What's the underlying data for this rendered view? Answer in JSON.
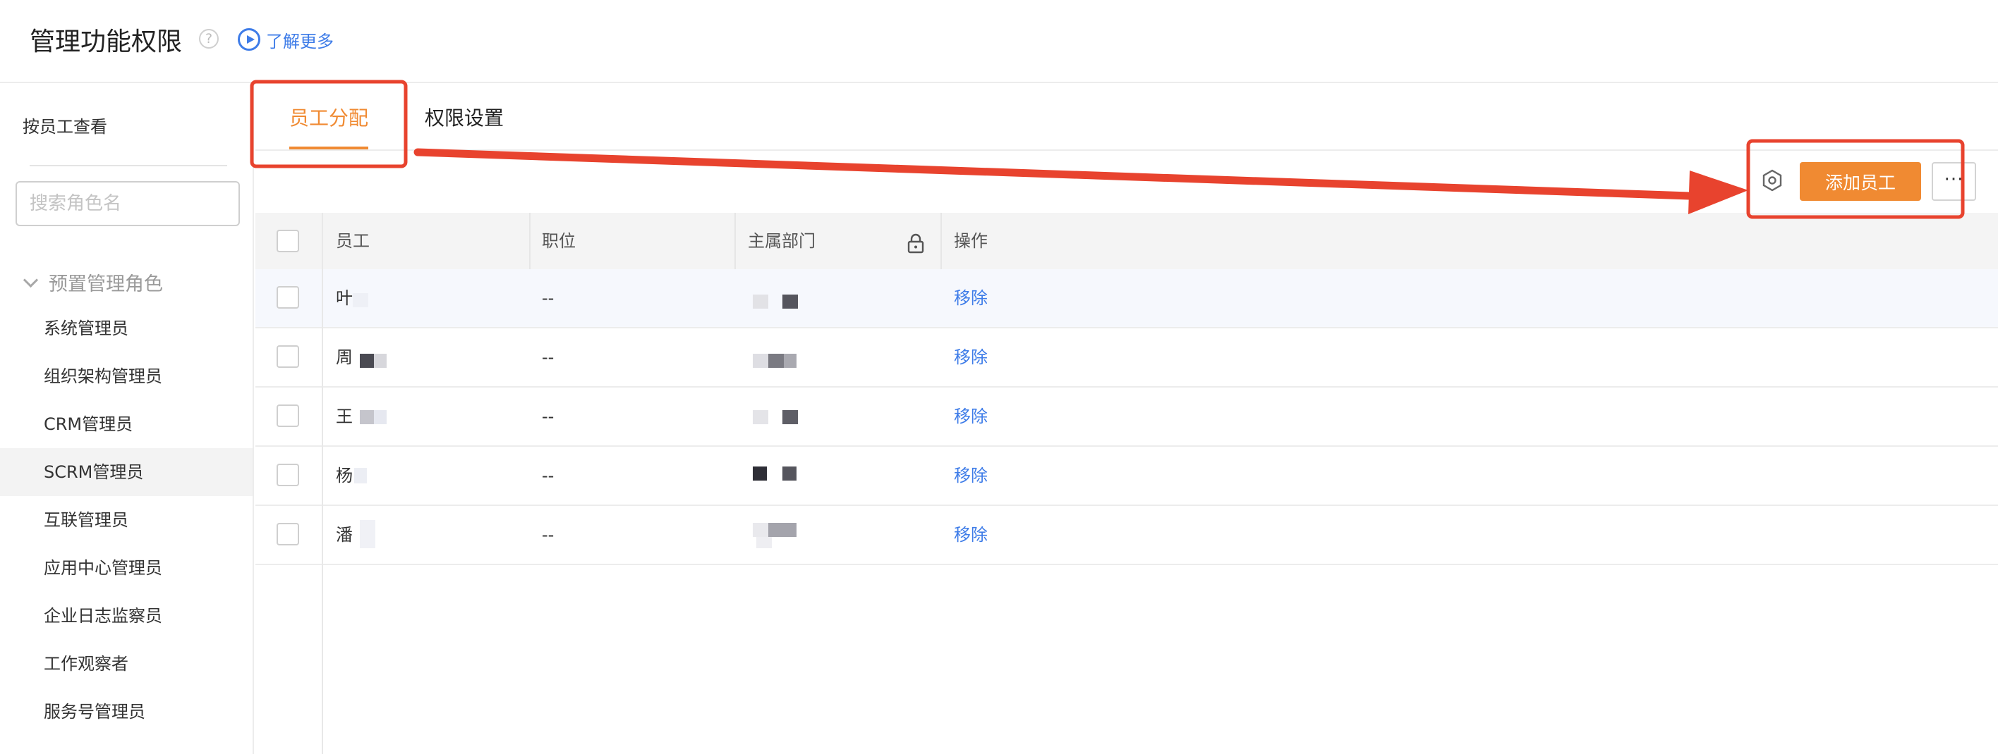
{
  "header": {
    "title": "管理功能权限",
    "help_icon": "question-circle-icon",
    "help_glyph": "?",
    "learn_more": "了解更多",
    "learn_more_icon": "play-circle-icon"
  },
  "sidebar": {
    "heading": "按员工查看",
    "search_placeholder": "搜索角色名",
    "group": {
      "label": "预置管理角色",
      "expanded": true,
      "icon": "chevron-down-icon"
    },
    "roles": [
      {
        "label": "系统管理员"
      },
      {
        "label": "组织架构管理员"
      },
      {
        "label": "CRM管理员"
      },
      {
        "label": "SCRM管理员",
        "selected": true
      },
      {
        "label": "互联管理员"
      },
      {
        "label": "应用中心管理员"
      },
      {
        "label": "企业日志监察员"
      },
      {
        "label": "工作观察者"
      },
      {
        "label": "服务号管理员"
      }
    ]
  },
  "tabs": [
    {
      "label": "员工分配",
      "active": true
    },
    {
      "label": "权限设置",
      "active": false
    }
  ],
  "toolbar": {
    "settings_icon": "hexagon-gear-icon",
    "add_label": "添加员工",
    "more_label": "···"
  },
  "table": {
    "columns": [
      "员工",
      "职位",
      "主属部门",
      "操作"
    ],
    "department_lock_icon": "lock-icon",
    "rows": [
      {
        "employee": "叶",
        "position": "--",
        "action": "移除"
      },
      {
        "employee": "周",
        "position": "--",
        "action": "移除"
      },
      {
        "employee": "王",
        "position": "--",
        "action": "移除"
      },
      {
        "employee": "杨",
        "position": "--",
        "action": "移除"
      },
      {
        "employee": "潘",
        "position": "--",
        "action": "移除"
      }
    ]
  },
  "colors": {
    "accent": "#f08a32",
    "link": "#3e7ce8",
    "annotation": "#e8432e"
  }
}
